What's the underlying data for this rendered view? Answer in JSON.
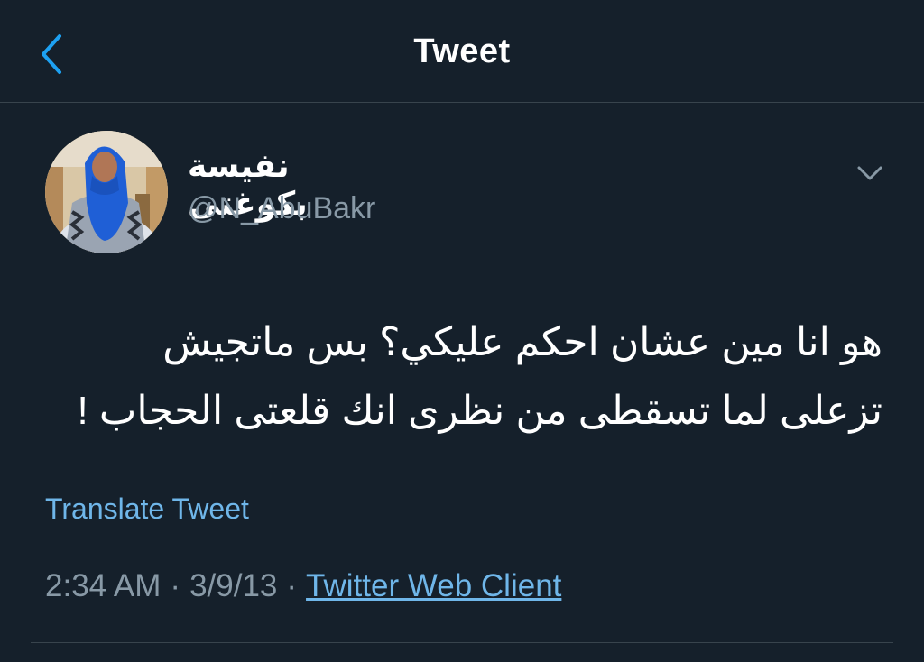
{
  "header": {
    "title": "Tweet"
  },
  "tweet": {
    "display_name": "نفيسة بكوغتى",
    "handle": "@N_AbuBakr",
    "text_lines": [
      "هو انا مين عشان احكم عليكي؟ بس ماتجيش",
      "تزعلى لما تسقطى من نظرى انك قلعتى الحجاب !"
    ],
    "translate_label": "Translate Tweet",
    "time": "2:34 AM",
    "date": "3/9/13",
    "separator": "·",
    "client": "Twitter Web Client"
  },
  "colors": {
    "background": "#15202b",
    "accent": "#1da1f2",
    "secondary_text": "#8899a6",
    "divider": "#38444d"
  },
  "icons": {
    "back": "chevron-left-icon",
    "more": "chevron-down-icon"
  }
}
